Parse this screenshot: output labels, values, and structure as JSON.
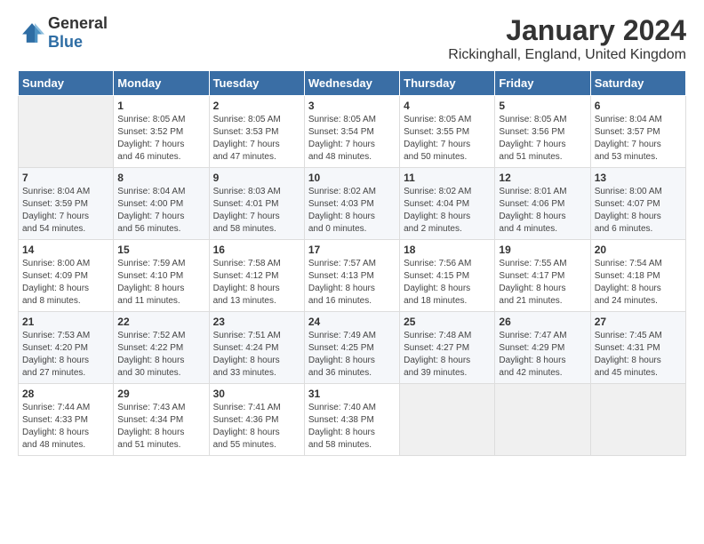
{
  "logo": {
    "general": "General",
    "blue": "Blue"
  },
  "title": "January 2024",
  "subtitle": "Rickinghall, England, United Kingdom",
  "weekdays": [
    "Sunday",
    "Monday",
    "Tuesday",
    "Wednesday",
    "Thursday",
    "Friday",
    "Saturday"
  ],
  "weeks": [
    [
      {
        "day": "",
        "content": ""
      },
      {
        "day": "1",
        "content": "Sunrise: 8:05 AM\nSunset: 3:52 PM\nDaylight: 7 hours\nand 46 minutes."
      },
      {
        "day": "2",
        "content": "Sunrise: 8:05 AM\nSunset: 3:53 PM\nDaylight: 7 hours\nand 47 minutes."
      },
      {
        "day": "3",
        "content": "Sunrise: 8:05 AM\nSunset: 3:54 PM\nDaylight: 7 hours\nand 48 minutes."
      },
      {
        "day": "4",
        "content": "Sunrise: 8:05 AM\nSunset: 3:55 PM\nDaylight: 7 hours\nand 50 minutes."
      },
      {
        "day": "5",
        "content": "Sunrise: 8:05 AM\nSunset: 3:56 PM\nDaylight: 7 hours\nand 51 minutes."
      },
      {
        "day": "6",
        "content": "Sunrise: 8:04 AM\nSunset: 3:57 PM\nDaylight: 7 hours\nand 53 minutes."
      }
    ],
    [
      {
        "day": "7",
        "content": "Sunrise: 8:04 AM\nSunset: 3:59 PM\nDaylight: 7 hours\nand 54 minutes."
      },
      {
        "day": "8",
        "content": "Sunrise: 8:04 AM\nSunset: 4:00 PM\nDaylight: 7 hours\nand 56 minutes."
      },
      {
        "day": "9",
        "content": "Sunrise: 8:03 AM\nSunset: 4:01 PM\nDaylight: 7 hours\nand 58 minutes."
      },
      {
        "day": "10",
        "content": "Sunrise: 8:02 AM\nSunset: 4:03 PM\nDaylight: 8 hours\nand 0 minutes."
      },
      {
        "day": "11",
        "content": "Sunrise: 8:02 AM\nSunset: 4:04 PM\nDaylight: 8 hours\nand 2 minutes."
      },
      {
        "day": "12",
        "content": "Sunrise: 8:01 AM\nSunset: 4:06 PM\nDaylight: 8 hours\nand 4 minutes."
      },
      {
        "day": "13",
        "content": "Sunrise: 8:00 AM\nSunset: 4:07 PM\nDaylight: 8 hours\nand 6 minutes."
      }
    ],
    [
      {
        "day": "14",
        "content": "Sunrise: 8:00 AM\nSunset: 4:09 PM\nDaylight: 8 hours\nand 8 minutes."
      },
      {
        "day": "15",
        "content": "Sunrise: 7:59 AM\nSunset: 4:10 PM\nDaylight: 8 hours\nand 11 minutes."
      },
      {
        "day": "16",
        "content": "Sunrise: 7:58 AM\nSunset: 4:12 PM\nDaylight: 8 hours\nand 13 minutes."
      },
      {
        "day": "17",
        "content": "Sunrise: 7:57 AM\nSunset: 4:13 PM\nDaylight: 8 hours\nand 16 minutes."
      },
      {
        "day": "18",
        "content": "Sunrise: 7:56 AM\nSunset: 4:15 PM\nDaylight: 8 hours\nand 18 minutes."
      },
      {
        "day": "19",
        "content": "Sunrise: 7:55 AM\nSunset: 4:17 PM\nDaylight: 8 hours\nand 21 minutes."
      },
      {
        "day": "20",
        "content": "Sunrise: 7:54 AM\nSunset: 4:18 PM\nDaylight: 8 hours\nand 24 minutes."
      }
    ],
    [
      {
        "day": "21",
        "content": "Sunrise: 7:53 AM\nSunset: 4:20 PM\nDaylight: 8 hours\nand 27 minutes."
      },
      {
        "day": "22",
        "content": "Sunrise: 7:52 AM\nSunset: 4:22 PM\nDaylight: 8 hours\nand 30 minutes."
      },
      {
        "day": "23",
        "content": "Sunrise: 7:51 AM\nSunset: 4:24 PM\nDaylight: 8 hours\nand 33 minutes."
      },
      {
        "day": "24",
        "content": "Sunrise: 7:49 AM\nSunset: 4:25 PM\nDaylight: 8 hours\nand 36 minutes."
      },
      {
        "day": "25",
        "content": "Sunrise: 7:48 AM\nSunset: 4:27 PM\nDaylight: 8 hours\nand 39 minutes."
      },
      {
        "day": "26",
        "content": "Sunrise: 7:47 AM\nSunset: 4:29 PM\nDaylight: 8 hours\nand 42 minutes."
      },
      {
        "day": "27",
        "content": "Sunrise: 7:45 AM\nSunset: 4:31 PM\nDaylight: 8 hours\nand 45 minutes."
      }
    ],
    [
      {
        "day": "28",
        "content": "Sunrise: 7:44 AM\nSunset: 4:33 PM\nDaylight: 8 hours\nand 48 minutes."
      },
      {
        "day": "29",
        "content": "Sunrise: 7:43 AM\nSunset: 4:34 PM\nDaylight: 8 hours\nand 51 minutes."
      },
      {
        "day": "30",
        "content": "Sunrise: 7:41 AM\nSunset: 4:36 PM\nDaylight: 8 hours\nand 55 minutes."
      },
      {
        "day": "31",
        "content": "Sunrise: 7:40 AM\nSunset: 4:38 PM\nDaylight: 8 hours\nand 58 minutes."
      },
      {
        "day": "",
        "content": ""
      },
      {
        "day": "",
        "content": ""
      },
      {
        "day": "",
        "content": ""
      }
    ]
  ]
}
